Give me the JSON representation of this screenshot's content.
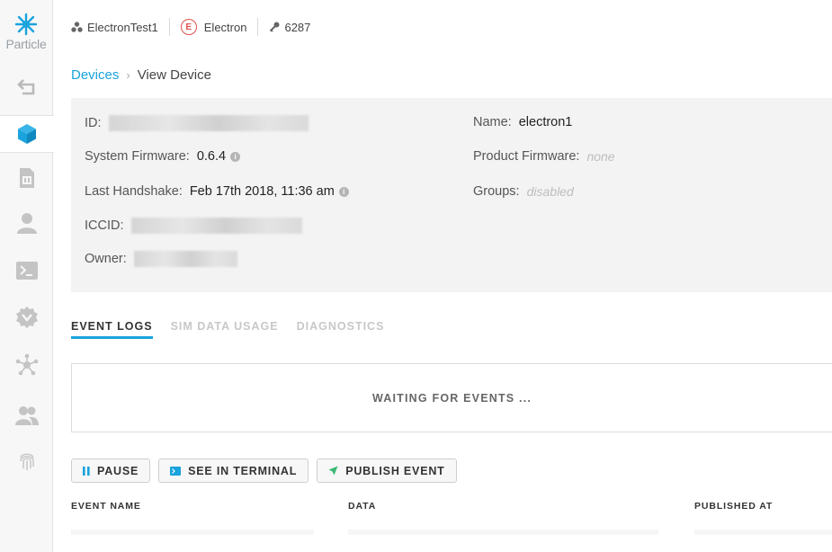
{
  "sidebar": {
    "logo_text": "Particle",
    "items": [
      {
        "icon": "back-arrow-icon"
      },
      {
        "icon": "cube-icon",
        "active": true
      },
      {
        "icon": "sim-card-icon"
      },
      {
        "icon": "user-icon"
      },
      {
        "icon": "terminal-icon"
      },
      {
        "icon": "integrations-icon"
      },
      {
        "icon": "network-icon"
      },
      {
        "icon": "team-icon"
      },
      {
        "icon": "fingerprint-icon"
      }
    ]
  },
  "topbar": {
    "product_name": "ElectronTest1",
    "platform_badge": "E",
    "platform_name": "Electron",
    "product_id": "6287"
  },
  "breadcrumb": {
    "parent": "Devices",
    "current": "View Device"
  },
  "device": {
    "id_label": "ID:",
    "system_firmware_label": "System Firmware:",
    "system_firmware_value": "0.6.4",
    "last_handshake_label": "Last Handshake:",
    "last_handshake_value": "Feb 17th 2018, 11:36 am",
    "iccid_label": "ICCID:",
    "owner_label": "Owner:",
    "name_label": "Name:",
    "name_value": "electron1",
    "product_firmware_label": "Product Firmware:",
    "product_firmware_value": "none",
    "groups_label": "Groups:",
    "groups_value": "disabled",
    "info_glyph": "i"
  },
  "tabs": [
    {
      "label": "EVENT LOGS",
      "active": true
    },
    {
      "label": "SIM DATA USAGE",
      "active": false
    },
    {
      "label": "DIAGNOSTICS",
      "active": false
    }
  ],
  "events": {
    "waiting_text": "WAITING FOR EVENTS ..."
  },
  "buttons": {
    "pause": "PAUSE",
    "terminal": "SEE IN TERMINAL",
    "publish": "PUBLISH EVENT"
  },
  "table": {
    "headers": [
      "EVENT NAME",
      "DATA",
      "PUBLISHED AT"
    ]
  },
  "colors": {
    "accent": "#1aa3dd",
    "electron_badge": "#e0504b",
    "publish_icon": "#3bb873"
  }
}
